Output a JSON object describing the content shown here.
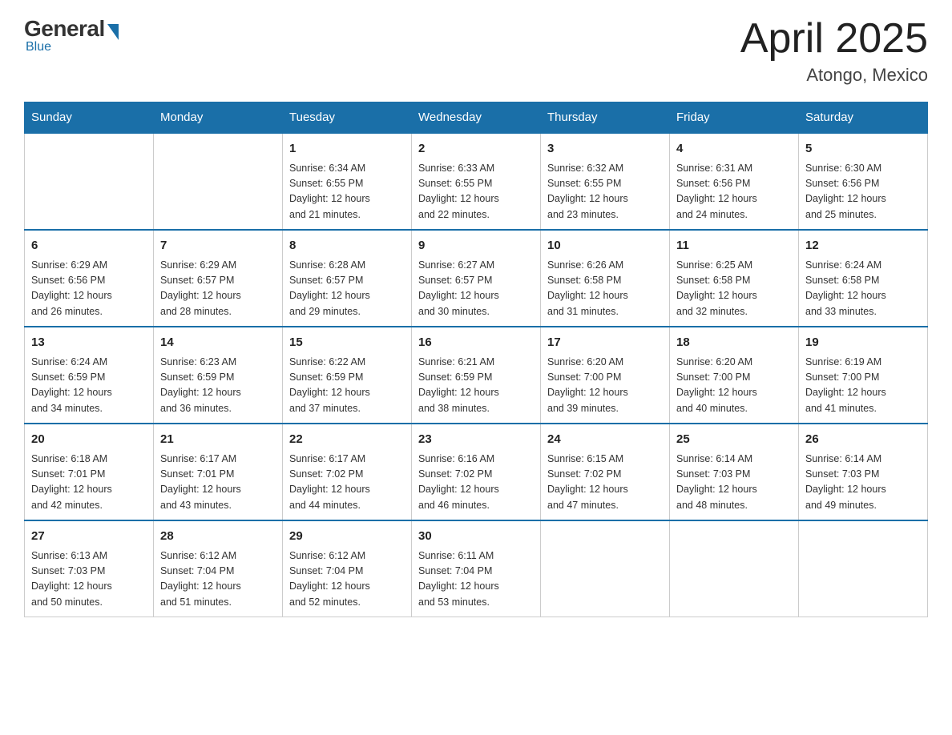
{
  "logo": {
    "general": "General",
    "blue": "Blue",
    "subtitle": "Blue"
  },
  "title": "April 2025",
  "location": "Atongo, Mexico",
  "days_of_week": [
    "Sunday",
    "Monday",
    "Tuesday",
    "Wednesday",
    "Thursday",
    "Friday",
    "Saturday"
  ],
  "weeks": [
    [
      {
        "day": "",
        "info": ""
      },
      {
        "day": "",
        "info": ""
      },
      {
        "day": "1",
        "info": "Sunrise: 6:34 AM\nSunset: 6:55 PM\nDaylight: 12 hours\nand 21 minutes."
      },
      {
        "day": "2",
        "info": "Sunrise: 6:33 AM\nSunset: 6:55 PM\nDaylight: 12 hours\nand 22 minutes."
      },
      {
        "day": "3",
        "info": "Sunrise: 6:32 AM\nSunset: 6:55 PM\nDaylight: 12 hours\nand 23 minutes."
      },
      {
        "day": "4",
        "info": "Sunrise: 6:31 AM\nSunset: 6:56 PM\nDaylight: 12 hours\nand 24 minutes."
      },
      {
        "day": "5",
        "info": "Sunrise: 6:30 AM\nSunset: 6:56 PM\nDaylight: 12 hours\nand 25 minutes."
      }
    ],
    [
      {
        "day": "6",
        "info": "Sunrise: 6:29 AM\nSunset: 6:56 PM\nDaylight: 12 hours\nand 26 minutes."
      },
      {
        "day": "7",
        "info": "Sunrise: 6:29 AM\nSunset: 6:57 PM\nDaylight: 12 hours\nand 28 minutes."
      },
      {
        "day": "8",
        "info": "Sunrise: 6:28 AM\nSunset: 6:57 PM\nDaylight: 12 hours\nand 29 minutes."
      },
      {
        "day": "9",
        "info": "Sunrise: 6:27 AM\nSunset: 6:57 PM\nDaylight: 12 hours\nand 30 minutes."
      },
      {
        "day": "10",
        "info": "Sunrise: 6:26 AM\nSunset: 6:58 PM\nDaylight: 12 hours\nand 31 minutes."
      },
      {
        "day": "11",
        "info": "Sunrise: 6:25 AM\nSunset: 6:58 PM\nDaylight: 12 hours\nand 32 minutes."
      },
      {
        "day": "12",
        "info": "Sunrise: 6:24 AM\nSunset: 6:58 PM\nDaylight: 12 hours\nand 33 minutes."
      }
    ],
    [
      {
        "day": "13",
        "info": "Sunrise: 6:24 AM\nSunset: 6:59 PM\nDaylight: 12 hours\nand 34 minutes."
      },
      {
        "day": "14",
        "info": "Sunrise: 6:23 AM\nSunset: 6:59 PM\nDaylight: 12 hours\nand 36 minutes."
      },
      {
        "day": "15",
        "info": "Sunrise: 6:22 AM\nSunset: 6:59 PM\nDaylight: 12 hours\nand 37 minutes."
      },
      {
        "day": "16",
        "info": "Sunrise: 6:21 AM\nSunset: 6:59 PM\nDaylight: 12 hours\nand 38 minutes."
      },
      {
        "day": "17",
        "info": "Sunrise: 6:20 AM\nSunset: 7:00 PM\nDaylight: 12 hours\nand 39 minutes."
      },
      {
        "day": "18",
        "info": "Sunrise: 6:20 AM\nSunset: 7:00 PM\nDaylight: 12 hours\nand 40 minutes."
      },
      {
        "day": "19",
        "info": "Sunrise: 6:19 AM\nSunset: 7:00 PM\nDaylight: 12 hours\nand 41 minutes."
      }
    ],
    [
      {
        "day": "20",
        "info": "Sunrise: 6:18 AM\nSunset: 7:01 PM\nDaylight: 12 hours\nand 42 minutes."
      },
      {
        "day": "21",
        "info": "Sunrise: 6:17 AM\nSunset: 7:01 PM\nDaylight: 12 hours\nand 43 minutes."
      },
      {
        "day": "22",
        "info": "Sunrise: 6:17 AM\nSunset: 7:02 PM\nDaylight: 12 hours\nand 44 minutes."
      },
      {
        "day": "23",
        "info": "Sunrise: 6:16 AM\nSunset: 7:02 PM\nDaylight: 12 hours\nand 46 minutes."
      },
      {
        "day": "24",
        "info": "Sunrise: 6:15 AM\nSunset: 7:02 PM\nDaylight: 12 hours\nand 47 minutes."
      },
      {
        "day": "25",
        "info": "Sunrise: 6:14 AM\nSunset: 7:03 PM\nDaylight: 12 hours\nand 48 minutes."
      },
      {
        "day": "26",
        "info": "Sunrise: 6:14 AM\nSunset: 7:03 PM\nDaylight: 12 hours\nand 49 minutes."
      }
    ],
    [
      {
        "day": "27",
        "info": "Sunrise: 6:13 AM\nSunset: 7:03 PM\nDaylight: 12 hours\nand 50 minutes."
      },
      {
        "day": "28",
        "info": "Sunrise: 6:12 AM\nSunset: 7:04 PM\nDaylight: 12 hours\nand 51 minutes."
      },
      {
        "day": "29",
        "info": "Sunrise: 6:12 AM\nSunset: 7:04 PM\nDaylight: 12 hours\nand 52 minutes."
      },
      {
        "day": "30",
        "info": "Sunrise: 6:11 AM\nSunset: 7:04 PM\nDaylight: 12 hours\nand 53 minutes."
      },
      {
        "day": "",
        "info": ""
      },
      {
        "day": "",
        "info": ""
      },
      {
        "day": "",
        "info": ""
      }
    ]
  ]
}
